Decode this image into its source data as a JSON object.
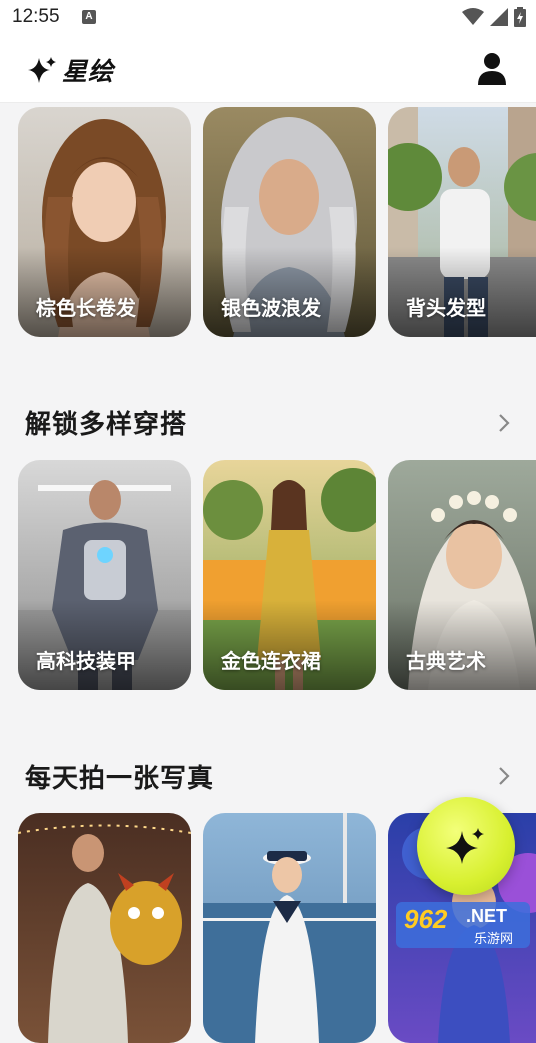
{
  "status_bar": {
    "time": "12:55",
    "notice_badge": "A"
  },
  "app": {
    "title": "星绘"
  },
  "rows": [
    {
      "cards": [
        {
          "label": "棕色长卷发"
        },
        {
          "label": "银色波浪发"
        },
        {
          "label": "背头发型"
        }
      ]
    },
    {
      "title": "解锁多样穿搭",
      "cards": [
        {
          "label": "高科技装甲"
        },
        {
          "label": "金色连衣裙"
        },
        {
          "label": "古典艺术"
        }
      ]
    },
    {
      "title": "每天拍一张写真",
      "cards": [
        {
          "label": ""
        },
        {
          "label": ""
        },
        {
          "label": ""
        }
      ]
    }
  ],
  "watermark": {
    "number": "962",
    "suffix": ".NET",
    "caption": "乐游网"
  },
  "colors": {
    "accent": "#d8f030",
    "background": "#f4f4f5"
  }
}
